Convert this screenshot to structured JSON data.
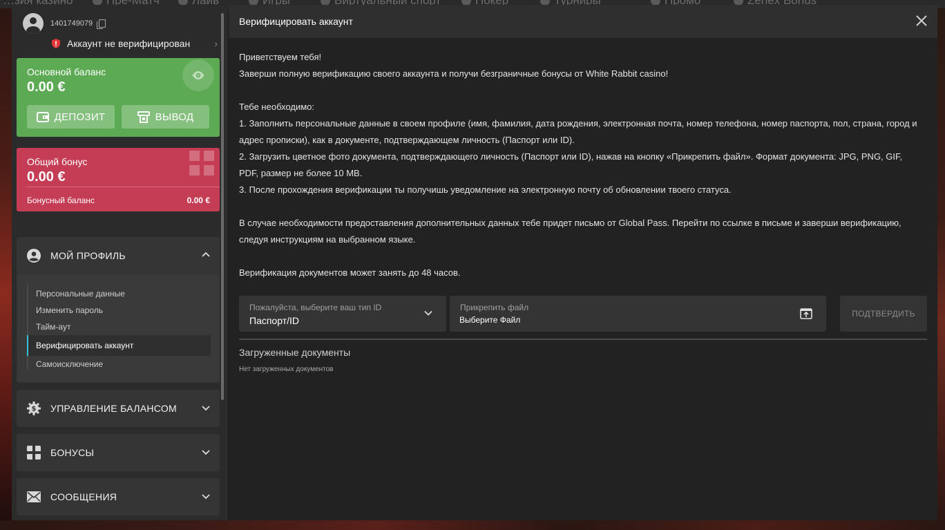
{
  "background_nav": {
    "items": [
      "…зия казино",
      "Пре-Матч",
      "Лайв",
      "Игры",
      "Виртуальный спорт",
      "Покер",
      "Турниры",
      "Промо",
      "Zenex Bonus"
    ]
  },
  "sidebar": {
    "user_id": "1401749079",
    "verify_status": "Аккаунт не верифицирован",
    "main_balance": {
      "title": "Основной баланс",
      "amount": "0.00 €",
      "deposit_label": "ДЕПОЗИТ",
      "withdraw_label": "ВЫВОД"
    },
    "bonus_balance": {
      "title": "Общий бонус",
      "amount": "0.00 €",
      "sub_label": "Бонусный баланс",
      "sub_value": "0.00 €"
    },
    "profile": {
      "label": "МОЙ ПРОФИЛЬ",
      "items": [
        "Персональные данные",
        "Изменить пароль",
        "Тайм-аут",
        "Верифицировать аккаунт",
        "Самоисключение"
      ],
      "active_index": 3
    },
    "balance_management_label": "УПРАВЛЕНИЕ БАЛАНСОМ",
    "bonuses_label": "БОНУСЫ",
    "messages_label": "СООБЩЕНИЯ"
  },
  "modal": {
    "title": "Верифицировать аккаунт",
    "greeting": "Приветствуем тебя!",
    "intro": "Заверши полную верификацию своего аккаунта и получи безграничные бонусы от White Rabbit casino!",
    "need_title": "Тебе необходимо:",
    "step1": "1. Заполнить персональные данные в своем профиле (имя, фамилия, дата рождения, электронная почта, номер телефона, номер паспорта, пол, страна, город и адрес прописки), как в документе, подтверждающем личность (Паспорт или ID).",
    "step2": "2. Загрузить цветное фото документа, подтверждающего личность (Паспорт или ID), нажав на кнопку «Прикрепить файл». Формат документа: JPG, PNG, GIF, PDF, размер не более 10 MB.",
    "step3": "3. После прохождения верификации ты получишь уведомление на электронную почту об обновлении твоего статуса.",
    "global_pass": "В случае необходимости предоставления дополнительных данных тебе придет письмо от Global Pass. Перейти по ссылке в письме и заверши верификацию, следуя инструкциям на выбранном языке.",
    "duration": "Верификация документов может занять до 48 часов.",
    "id_type": {
      "label": "Пожалуйста, выберите ваш тип ID",
      "value": "Паспорт/ID"
    },
    "attach": {
      "label": "Прикрепить файл",
      "value": "Выберите Файл"
    },
    "confirm_label": "ПОДТВЕРДИТЬ",
    "docs_title": "Загруженные документы",
    "docs_empty": "Нет загруженных документов"
  },
  "colors": {
    "main_card": "#5cab54",
    "bonus_card": "#c43d55",
    "active_accent": "#39c1d9"
  }
}
